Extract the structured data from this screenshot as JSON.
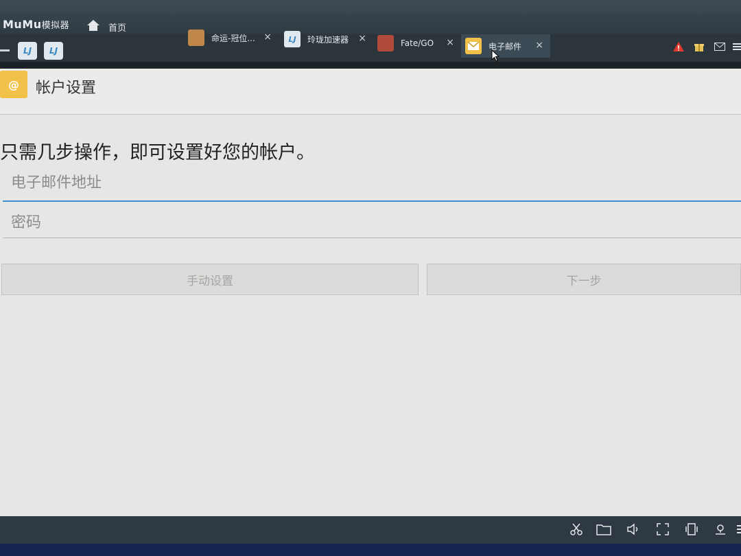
{
  "brand": {
    "name": "MuMu",
    "suffix": "模拟器"
  },
  "home": {
    "label": "首页"
  },
  "tabs": [
    {
      "label": "命运-冠位...",
      "icon": "game-thumb-icon",
      "color": "#c08848"
    },
    {
      "label": "玲珑加速器",
      "icon": "ll-accelerator-icon",
      "color": "#dfe9ee"
    },
    {
      "label": "Fate/GO",
      "icon": "game-thumb-icon",
      "color": "#b04a3a"
    },
    {
      "label": "电子邮件",
      "icon": "email-app-icon",
      "color": "#f2c14a"
    }
  ],
  "tab_close": "×",
  "quick_buttons": [
    "LJ",
    "LJ"
  ],
  "app": {
    "title": "帐户设置",
    "headline": "只需几步操作，即可设置好您的帐户。",
    "email_placeholder": "电子邮件地址",
    "password_placeholder": "密码",
    "manual_button": "手动设置",
    "next_button": "下一步"
  },
  "colors": {
    "accent": "#3b8fd0",
    "titlebar": "#333d45",
    "app_bg": "#e6e6e4"
  }
}
